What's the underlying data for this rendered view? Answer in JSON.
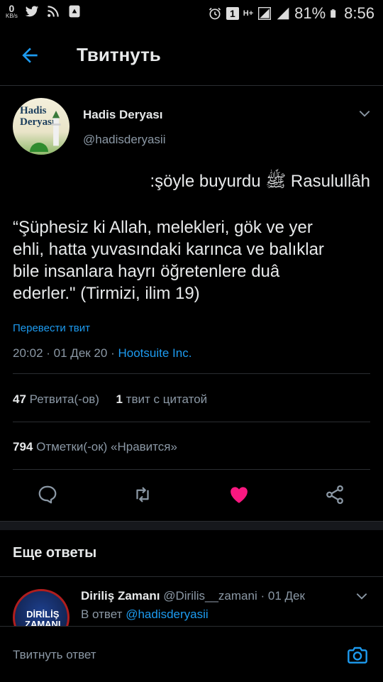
{
  "status_bar": {
    "net_speed": "0",
    "net_unit": "KB/s",
    "sim_badge": "1",
    "network_type": "H+",
    "battery": "81%",
    "time": "8:56"
  },
  "header": {
    "title": "Твитнуть"
  },
  "tweet": {
    "author_name": "Hadis Deryası",
    "author_handle": "@hadisderyasii",
    "avatar_text": "Hadis\nDeryası",
    "line1": ":şöyle buyurdu ﷺ Rasulullâh",
    "text": "“Şüphesiz ki Allah, melekleri, gök ve yer\nehli, hatta yuvasındaki karınca ve balıklar\nbile insanlara hayrı öğretenlere duâ\nederler.\" (Tirmizi, ilim 19)",
    "translate_label": "Перевести твит",
    "time": "20:02",
    "date": "01 Дек 20",
    "source": "Hootsuite Inc."
  },
  "stats": {
    "retweets_count": "47",
    "retweets_label": "Ретвита(-ов)",
    "quotes_count": "1",
    "quotes_label": "твит с цитатой",
    "likes_count": "794",
    "likes_label": "Отметки(-ок) «Нравится»"
  },
  "actions": {
    "reply_icon": "reply-icon",
    "retweet_icon": "retweet-icon",
    "like_icon": "heart-icon",
    "share_icon": "share-icon",
    "like_color": "#f91880"
  },
  "more_replies": {
    "title": "Еще ответы",
    "reply": {
      "name": "Diriliş Zamanı",
      "handle": "@Dirilis__zamani",
      "date": "01 Дек",
      "reply_prefix": "В ответ",
      "reply_to": "@hadisderyasii",
      "avatar_text": "DİRİLİŞ\nZAMANI"
    }
  },
  "composer": {
    "placeholder": "Твитнуть ответ"
  },
  "colors": {
    "accent": "#1d9bf0",
    "background": "#000000",
    "muted": "#8b98a5"
  }
}
